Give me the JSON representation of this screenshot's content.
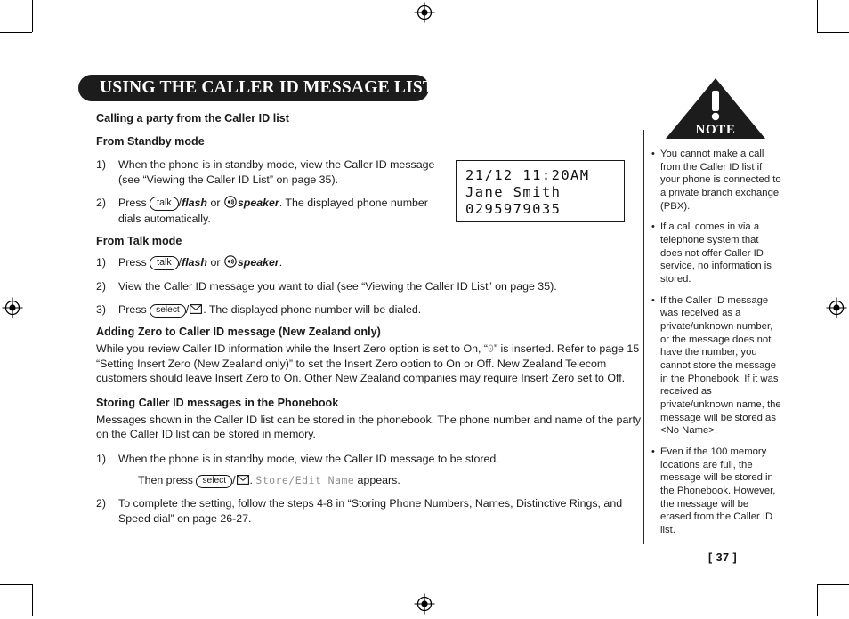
{
  "page": {
    "title": "USING THE CALLER ID MESSAGE LIST",
    "page_number": "[ 37 ]"
  },
  "main": {
    "section_calling": {
      "heading": "Calling a party from the Caller ID list",
      "standby_heading": "From Standby mode",
      "standby_steps": [
        {
          "num": "1)",
          "text": "When the phone is in standby mode, view the Caller ID message (see “Viewing the Caller ID List” on page 35)."
        },
        {
          "num": "2)",
          "pre": "Press ",
          "key1": "talk",
          "key1_suffix": "/",
          "key1_bold": "flash",
          "mid": " or ",
          "icon": "speaker-icon",
          "key2_bold": "speaker",
          "post": ". The displayed phone number dials automatically."
        }
      ],
      "talk_heading": "From Talk mode",
      "talk_steps": [
        {
          "num": "1)",
          "pre": "Press ",
          "key1": "talk",
          "key1_suffix": "/",
          "key1_bold": "flash",
          "mid": " or ",
          "icon": "speaker-icon",
          "key2_bold": "speaker",
          "post": "."
        },
        {
          "num": "2)",
          "text": "View the Caller ID message you want to dial (see “Viewing the Caller ID List” on page 35)."
        },
        {
          "num": "3)",
          "pre": "Press ",
          "key1": "select",
          "key1_suffix": "/",
          "icon": "envelope-icon",
          "post": ". The displayed phone number will be dialed."
        }
      ]
    },
    "section_zero": {
      "heading": "Adding Zero to Caller ID message (New Zealand only)",
      "para_part1": "While you review Caller ID information while the Insert Zero option is set to On, “",
      "lcd_zero": "0",
      "para_part2": "” is inserted. Refer to page 15 “Setting Insert Zero (New Zealand only)” to set the Insert Zero option to On or Off. New Zealand Telecom customers should leave Insert Zero to On. Other New Zealand companies may require Insert Zero set to Off."
    },
    "section_store": {
      "heading": "Storing Caller ID messages in the Phonebook",
      "intro": "Messages shown in the Caller ID list can be stored in the phonebook. The phone number and name of the party on the Caller ID list can be stored in memory.",
      "steps": [
        {
          "num": "1)",
          "text": "When the phone is in standby mode, view the Caller ID message to be stored.",
          "second_pre": "Then press ",
          "key1": "select",
          "key1_suffix": "/",
          "icon": "envelope-icon",
          "mid": ". ",
          "lcd_text": "Store/Edit Name",
          "post": " appears."
        },
        {
          "num": "2)",
          "text": "To complete the setting, follow the steps 4-8 in “Storing Phone Numbers, Names, Distinctive Rings, and Speed dial” on page 26-27."
        }
      ]
    }
  },
  "lcd_screen": {
    "line1": "21/12 11:20AM",
    "line2": "Jane Smith",
    "line3": "0295979035"
  },
  "sidebar": {
    "badge_label": "NOTE",
    "badge_icon": "warning-triangle-icon",
    "notes": [
      "You cannot make a call from the Caller ID list if your phone is connected to a private branch exchange (PBX).",
      "If a call comes in via a telephone system that does not offer Caller ID service, no information is stored.",
      "If the Caller ID message was received as a private/unknown number, or the message does not have the number, you cannot store the message in the Phonebook. If it was received as private/unknown name, the message will be stored as <No Name>.",
      "Even if the 100 memory locations are full, the message will be stored in the Phonebook. However, the message will be erased from the Caller ID list."
    ]
  },
  "colors": {
    "banner_bg": "#1c1c1c",
    "text": "#1a1a1a",
    "lcd_gray": "#8e8e8e"
  }
}
